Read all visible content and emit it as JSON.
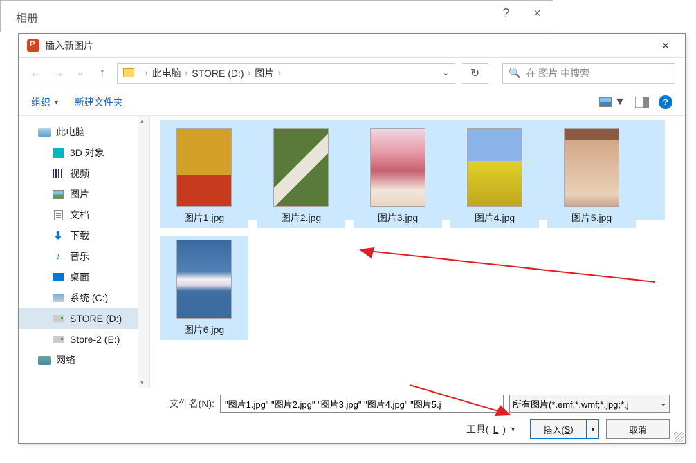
{
  "parent": {
    "title": "相册",
    "help": "?",
    "close": "×"
  },
  "dialog": {
    "title": "插入新图片",
    "close": "×"
  },
  "nav": {
    "breadcrumb": {
      "root": "此电脑",
      "drive": "STORE (D:)",
      "folder": "图片"
    },
    "refresh": "↻",
    "search_placeholder": "在 图片 中搜索"
  },
  "toolbar": {
    "organize": "组织",
    "new_folder": "新建文件夹"
  },
  "sidebar": {
    "this_pc": "此电脑",
    "items": [
      {
        "label": "3D 对象"
      },
      {
        "label": "视频"
      },
      {
        "label": "图片"
      },
      {
        "label": "文档"
      },
      {
        "label": "下载"
      },
      {
        "label": "音乐"
      },
      {
        "label": "桌面"
      },
      {
        "label": "系统 (C:)"
      },
      {
        "label": "STORE (D:)"
      },
      {
        "label": "Store-2 (E:)"
      },
      {
        "label": "网络"
      }
    ]
  },
  "files": [
    {
      "name": "图片1.jpg"
    },
    {
      "name": "图片2.jpg"
    },
    {
      "name": "图片3.jpg"
    },
    {
      "name": "图片4.jpg"
    },
    {
      "name": "图片5.jpg"
    },
    {
      "name": "图片6.jpg"
    }
  ],
  "footer": {
    "filename_label_pre": "文件名(",
    "filename_label_u": "N",
    "filename_label_post": "):",
    "filename_value": "\"图片1.jpg\" \"图片2.jpg\" \"图片3.jpg\" \"图片4.jpg\" \"图片5.j",
    "filetype": "所有图片(*.emf;*.wmf;*.jpg;*.j",
    "tools_pre": "工具(",
    "tools_u": "L",
    "tools_post": ")",
    "insert_pre": "插入(",
    "insert_u": "S",
    "insert_post": ")",
    "cancel": "取消"
  }
}
